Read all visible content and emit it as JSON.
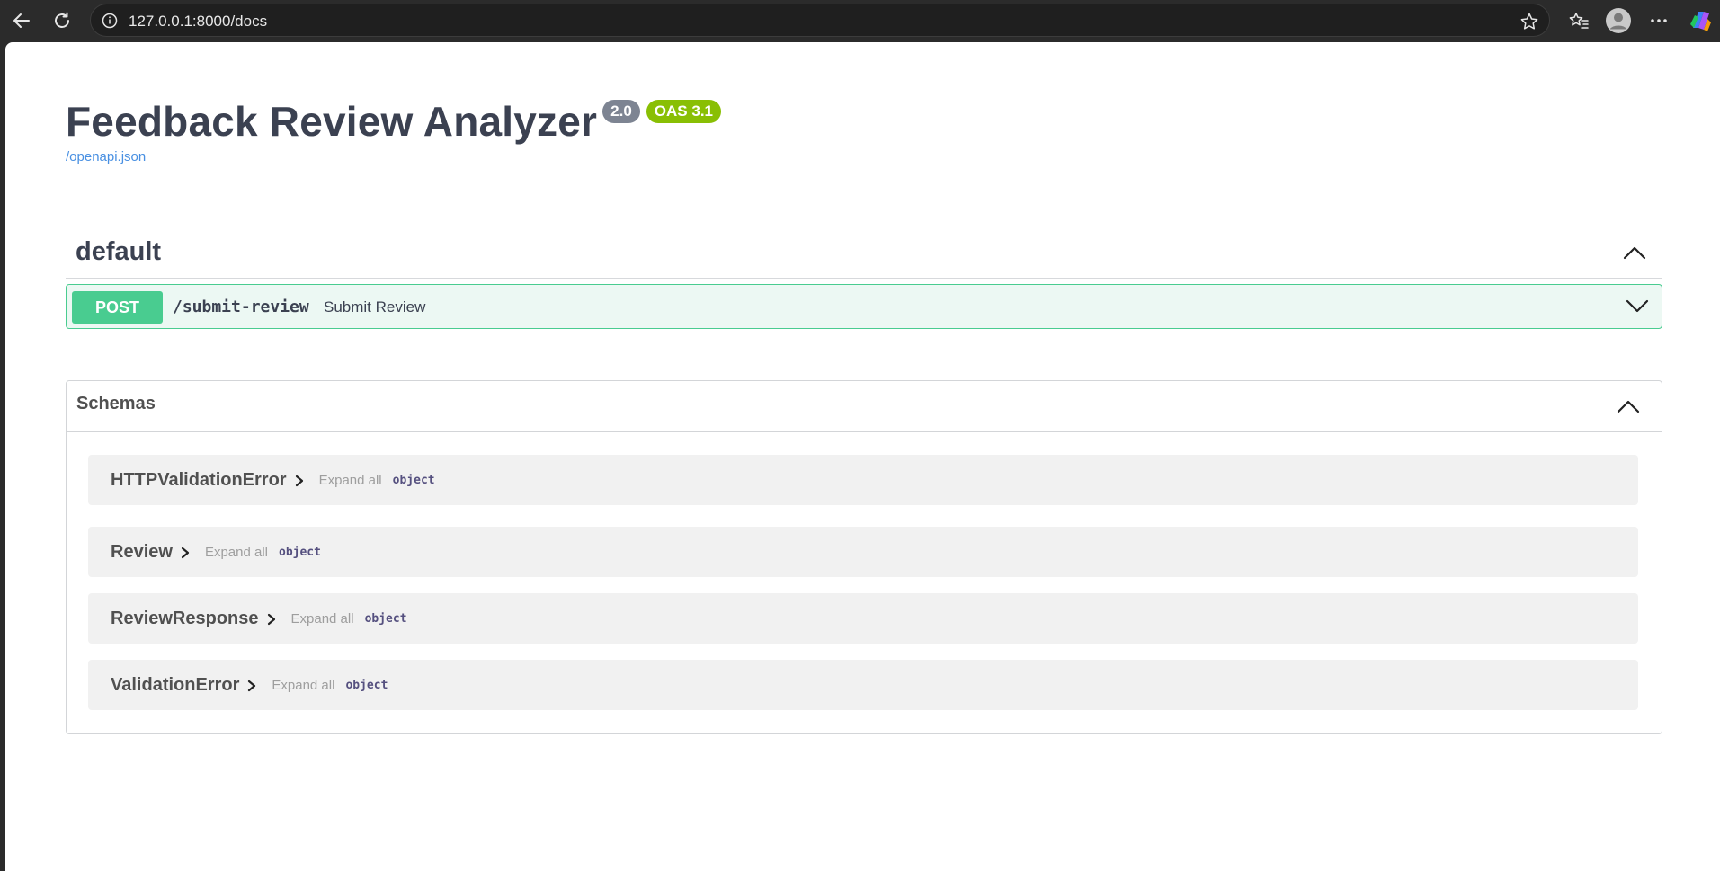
{
  "browser": {
    "url": "127.0.0.1:8000/docs",
    "icons": {
      "back": "back-arrow-icon",
      "reload": "reload-icon",
      "site_info": "info-icon",
      "favorite": "star-icon",
      "favorites_list": "favorites-icon",
      "profile": "profile-icon",
      "menu": "more-icon",
      "copilot": "copilot-icon"
    }
  },
  "api": {
    "title": "Feedback Review Analyzer",
    "version": "2.0",
    "oas_version": "OAS 3.1",
    "spec_link": "/openapi.json"
  },
  "tags": [
    {
      "name": "default",
      "operations": [
        {
          "method": "POST",
          "path": "/submit-review",
          "summary": "Submit Review"
        }
      ]
    }
  ],
  "schemas": {
    "title": "Schemas",
    "items": [
      {
        "name": "HTTPValidationError",
        "expand_label": "Expand all",
        "type": "object"
      },
      {
        "name": "Review",
        "expand_label": "Expand all",
        "type": "object"
      },
      {
        "name": "ReviewResponse",
        "expand_label": "Expand all",
        "type": "object"
      },
      {
        "name": "ValidationError",
        "expand_label": "Expand all",
        "type": "object"
      }
    ]
  },
  "colors": {
    "post": "#49cc90",
    "post_bg": "#ecf8f3",
    "version_badge": "#7d8492",
    "oas_badge": "#89bf04",
    "link": "#4990e2"
  }
}
